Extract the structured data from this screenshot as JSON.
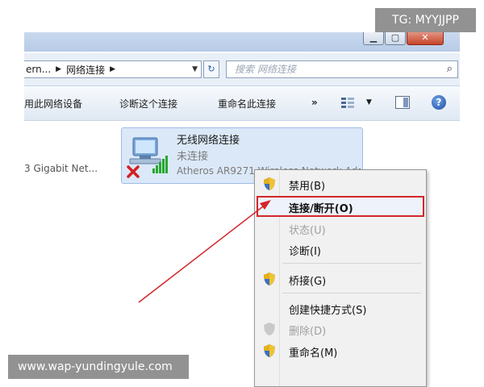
{
  "window": {
    "address": {
      "partial": "ern...",
      "current": "网络连接"
    },
    "search_placeholder": "搜索 网络连接"
  },
  "toolbar": {
    "disable_device": "用此网络设备",
    "diagnose": "诊断这个连接",
    "rename": "重命名此连接",
    "more": "»"
  },
  "adapters": {
    "left_partial_name": "3 Gigabit Net...",
    "wireless": {
      "name": "无线网络连接",
      "status": "未连接",
      "device": "Atheros AR9271 Wireless Network Adapter"
    }
  },
  "context_menu": {
    "items": [
      {
        "label": "禁用(B)",
        "icon": "shield-icon",
        "disabled": false
      },
      {
        "label": "连接/断开(O)",
        "icon": "",
        "disabled": false,
        "highlighted": true
      },
      {
        "label": "状态(U)",
        "icon": "",
        "disabled": true
      },
      {
        "label": "诊断(I)",
        "icon": "",
        "disabled": false
      },
      {
        "label": "桥接(G)",
        "icon": "shield-icon",
        "disabled": false
      },
      {
        "label": "创建快捷方式(S)",
        "icon": "",
        "disabled": false
      },
      {
        "label": "删除(D)",
        "icon": "shield-icon",
        "disabled": true
      },
      {
        "label": "重命名(M)",
        "icon": "shield-icon",
        "disabled": false
      }
    ]
  },
  "overlays": {
    "tg_tag": "TG: MYYJJPP",
    "watermark": "www.wap-yundingyule.com"
  },
  "colors": {
    "highlight_border": "#d3262a",
    "arrow": "#d3262a"
  }
}
